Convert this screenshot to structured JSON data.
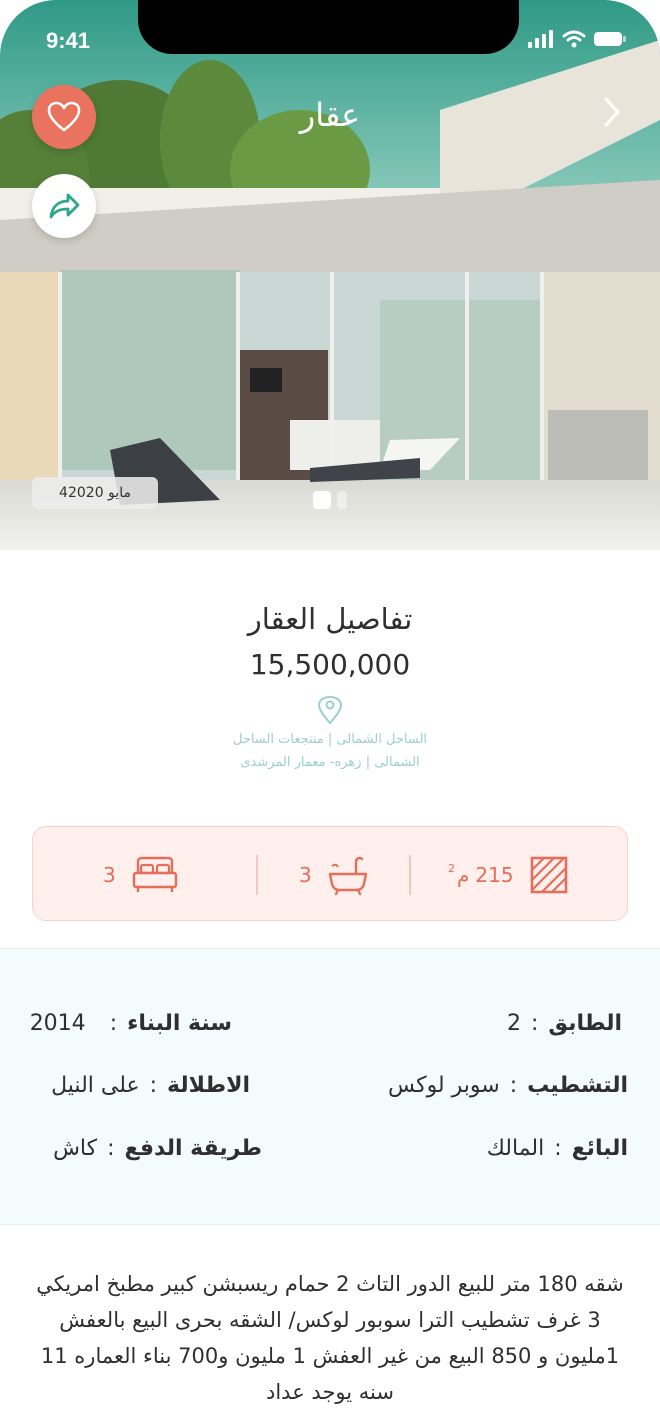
{
  "status_bar": {
    "time": "9:41"
  },
  "header": {
    "title": "عقار"
  },
  "gallery": {
    "date_label": "4مايو 2020",
    "slide_count": 2,
    "active_slide": 1
  },
  "details": {
    "section_title": "تفاصيل العقار",
    "price": "15,500,000",
    "location": "الساحل الشمالى | منتجعات الساحل الشمالى | زهره- معمار المرشدى"
  },
  "features": {
    "area": {
      "value": "215",
      "unit": "م",
      "unit_sup": "2",
      "icon": "area-icon"
    },
    "bathrooms": {
      "value": "3",
      "icon": "bathtub-icon"
    },
    "bedrooms": {
      "value": "3",
      "icon": "bed-icon"
    }
  },
  "specs": {
    "floor": {
      "label": "الطابق",
      "value": "2"
    },
    "build_year": {
      "label": "سنة البناء",
      "value": "2014"
    },
    "finishing": {
      "label": "التشطيب",
      "value": "سوبر لوكس"
    },
    "view": {
      "label": "الاطلالة",
      "value": "على النيل"
    },
    "seller": {
      "label": "البائع",
      "value": "المالك"
    },
    "payment": {
      "label": "طريقة الدفع",
      "value": "كاش"
    },
    "colon": ":"
  },
  "description": "شقه 180 متر للبيع الدور التاث 2 حمام ريسبشن كبير مطبخ امريكي 3 غرف تشطيب الترا سوبور لوكس/ الشقه بحرى البيع بالعفش 1مليون و 850 البيع من غير العفش 1 مليون و700 بناء العماره 11 سنه يوجد عداد",
  "colors": {
    "accent": "#e9735f",
    "teal": "#9ccfcf",
    "specs_bg": "#f4fbfd"
  }
}
